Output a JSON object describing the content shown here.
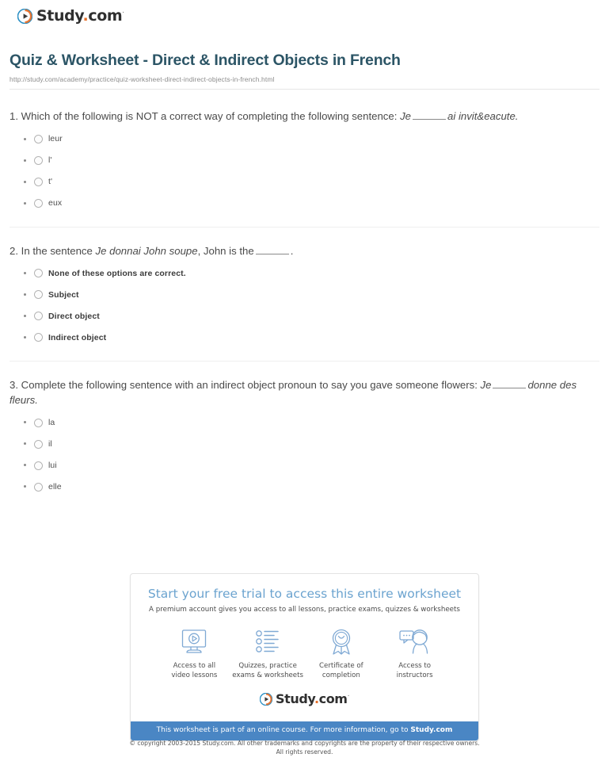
{
  "header": {
    "logo": {
      "text_main": "Study",
      "text_dot": ".",
      "text_com": "com",
      "registered": "·",
      "icon": "play-circle-icon"
    },
    "title": "Quiz & Worksheet - Direct & Indirect Objects in French",
    "url": "http://study.com/academy/practice/quiz-worksheet-direct-indirect-objects-in-french.html"
  },
  "questions": [
    {
      "number": "1.",
      "prompt_before": "Which of the following is NOT a correct way of completing the following sentence:",
      "italic_a": "Je",
      "has_blank": true,
      "italic_b": "ai invit&eacute.",
      "bold_options": false,
      "options": [
        {
          "label": "leur",
          "checked": false
        },
        {
          "label": "l'",
          "checked": false
        },
        {
          "label": "t'",
          "checked": false
        },
        {
          "label": "eux",
          "checked": false
        }
      ]
    },
    {
      "number": "2.",
      "prompt_before": "In the sentence",
      "italic_a": "Je donnai John soupe",
      "has_blank": true,
      "prompt_mid": ", John is the",
      "prompt_after": ".",
      "bold_options": true,
      "options": [
        {
          "label": "None of these options are correct.",
          "checked": false
        },
        {
          "label": "Subject",
          "checked": false
        },
        {
          "label": "Direct object",
          "checked": false
        },
        {
          "label": "Indirect object",
          "checked": false
        }
      ]
    },
    {
      "number": "3.",
      "prompt_before": "Complete the following sentence with an indirect object pronoun to say you gave someone flowers:",
      "italic_a": "Je",
      "has_blank": true,
      "italic_b": "donne des fleurs.",
      "bold_options": false,
      "options": [
        {
          "label": "la",
          "checked": false
        },
        {
          "label": "il",
          "checked": false
        },
        {
          "label": "lui",
          "checked": false
        },
        {
          "label": "elle",
          "checked": false
        }
      ]
    }
  ],
  "promo": {
    "headline": "Start your free trial to access this entire worksheet",
    "subhead": "A premium account gives you access to all lessons, practice exams, quizzes & worksheets",
    "features": [
      {
        "icon": "video-monitor-icon",
        "line1": "Access to all",
        "line2": "video lessons"
      },
      {
        "icon": "checklist-icon",
        "line1": "Quizzes, practice",
        "line2": "exams & worksheets"
      },
      {
        "icon": "certificate-ribbon-icon",
        "line1": "Certificate of",
        "line2": "completion"
      },
      {
        "icon": "instructor-chat-icon",
        "line1": "Access to",
        "line2": "instructors"
      }
    ],
    "logo": {
      "text_main": "Study",
      "text_dot": ".",
      "text_com": "com",
      "registered": "·"
    },
    "bar_text": "This worksheet is part of an online course. For more information, go to",
    "bar_link": "Study.com",
    "bar_color": "#4a86c4"
  },
  "footer": {
    "line1": "© copyright 2003-2015 Study.com. All other trademarks and copyrights are the property of their respective owners.",
    "line2": "All rights reserved."
  },
  "colors": {
    "title": "#2c5566",
    "accent_orange": "#e8702a",
    "accent_blue": "#2a8fc4",
    "promo_blue": "#6ba3cf",
    "bar_blue": "#4a86c4"
  }
}
